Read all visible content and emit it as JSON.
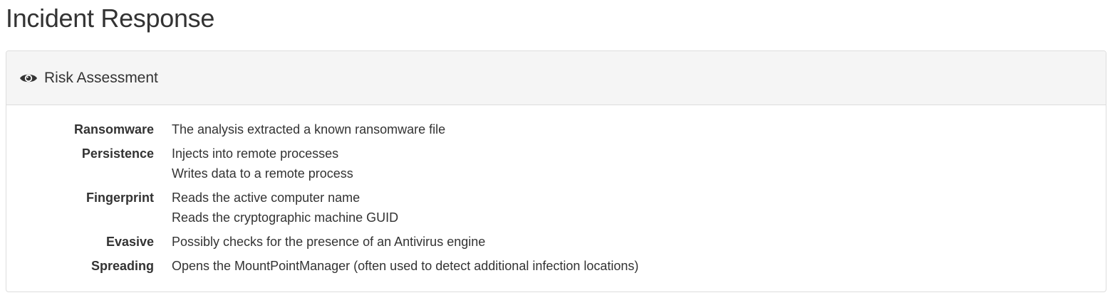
{
  "page": {
    "title": "Incident Response"
  },
  "panel": {
    "icon": "eye-icon",
    "title": "Risk Assessment"
  },
  "risks": [
    {
      "category": "Ransomware",
      "items": [
        "The analysis extracted a known ransomware file"
      ]
    },
    {
      "category": "Persistence",
      "items": [
        "Injects into remote processes",
        "Writes data to a remote process"
      ]
    },
    {
      "category": "Fingerprint",
      "items": [
        "Reads the active computer name",
        "Reads the cryptographic machine GUID"
      ]
    },
    {
      "category": "Evasive",
      "items": [
        "Possibly checks for the presence of an Antivirus engine"
      ]
    },
    {
      "category": "Spreading",
      "items": [
        "Opens the MountPointManager (often used to detect additional infection locations)"
      ]
    }
  ]
}
